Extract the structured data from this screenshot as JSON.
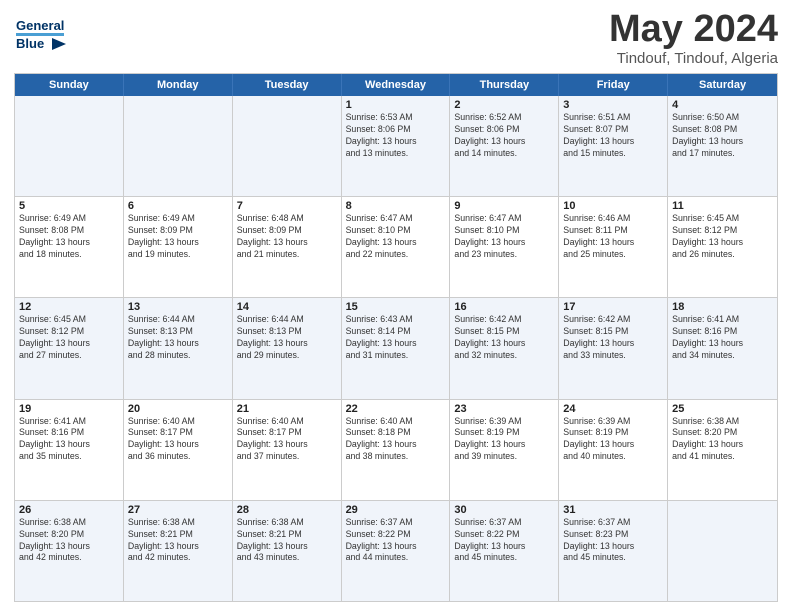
{
  "header": {
    "logo_line1": "General",
    "logo_line2": "Blue",
    "title": "May 2024",
    "location": "Tindouf, Tindouf, Algeria"
  },
  "weekdays": [
    "Sunday",
    "Monday",
    "Tuesday",
    "Wednesday",
    "Thursday",
    "Friday",
    "Saturday"
  ],
  "rows": [
    [
      {
        "day": "",
        "text": ""
      },
      {
        "day": "",
        "text": ""
      },
      {
        "day": "",
        "text": ""
      },
      {
        "day": "1",
        "text": "Sunrise: 6:53 AM\nSunset: 8:06 PM\nDaylight: 13 hours\nand 13 minutes."
      },
      {
        "day": "2",
        "text": "Sunrise: 6:52 AM\nSunset: 8:06 PM\nDaylight: 13 hours\nand 14 minutes."
      },
      {
        "day": "3",
        "text": "Sunrise: 6:51 AM\nSunset: 8:07 PM\nDaylight: 13 hours\nand 15 minutes."
      },
      {
        "day": "4",
        "text": "Sunrise: 6:50 AM\nSunset: 8:08 PM\nDaylight: 13 hours\nand 17 minutes."
      }
    ],
    [
      {
        "day": "5",
        "text": "Sunrise: 6:49 AM\nSunset: 8:08 PM\nDaylight: 13 hours\nand 18 minutes."
      },
      {
        "day": "6",
        "text": "Sunrise: 6:49 AM\nSunset: 8:09 PM\nDaylight: 13 hours\nand 19 minutes."
      },
      {
        "day": "7",
        "text": "Sunrise: 6:48 AM\nSunset: 8:09 PM\nDaylight: 13 hours\nand 21 minutes."
      },
      {
        "day": "8",
        "text": "Sunrise: 6:47 AM\nSunset: 8:10 PM\nDaylight: 13 hours\nand 22 minutes."
      },
      {
        "day": "9",
        "text": "Sunrise: 6:47 AM\nSunset: 8:10 PM\nDaylight: 13 hours\nand 23 minutes."
      },
      {
        "day": "10",
        "text": "Sunrise: 6:46 AM\nSunset: 8:11 PM\nDaylight: 13 hours\nand 25 minutes."
      },
      {
        "day": "11",
        "text": "Sunrise: 6:45 AM\nSunset: 8:12 PM\nDaylight: 13 hours\nand 26 minutes."
      }
    ],
    [
      {
        "day": "12",
        "text": "Sunrise: 6:45 AM\nSunset: 8:12 PM\nDaylight: 13 hours\nand 27 minutes."
      },
      {
        "day": "13",
        "text": "Sunrise: 6:44 AM\nSunset: 8:13 PM\nDaylight: 13 hours\nand 28 minutes."
      },
      {
        "day": "14",
        "text": "Sunrise: 6:44 AM\nSunset: 8:13 PM\nDaylight: 13 hours\nand 29 minutes."
      },
      {
        "day": "15",
        "text": "Sunrise: 6:43 AM\nSunset: 8:14 PM\nDaylight: 13 hours\nand 31 minutes."
      },
      {
        "day": "16",
        "text": "Sunrise: 6:42 AM\nSunset: 8:15 PM\nDaylight: 13 hours\nand 32 minutes."
      },
      {
        "day": "17",
        "text": "Sunrise: 6:42 AM\nSunset: 8:15 PM\nDaylight: 13 hours\nand 33 minutes."
      },
      {
        "day": "18",
        "text": "Sunrise: 6:41 AM\nSunset: 8:16 PM\nDaylight: 13 hours\nand 34 minutes."
      }
    ],
    [
      {
        "day": "19",
        "text": "Sunrise: 6:41 AM\nSunset: 8:16 PM\nDaylight: 13 hours\nand 35 minutes."
      },
      {
        "day": "20",
        "text": "Sunrise: 6:40 AM\nSunset: 8:17 PM\nDaylight: 13 hours\nand 36 minutes."
      },
      {
        "day": "21",
        "text": "Sunrise: 6:40 AM\nSunset: 8:17 PM\nDaylight: 13 hours\nand 37 minutes."
      },
      {
        "day": "22",
        "text": "Sunrise: 6:40 AM\nSunset: 8:18 PM\nDaylight: 13 hours\nand 38 minutes."
      },
      {
        "day": "23",
        "text": "Sunrise: 6:39 AM\nSunset: 8:19 PM\nDaylight: 13 hours\nand 39 minutes."
      },
      {
        "day": "24",
        "text": "Sunrise: 6:39 AM\nSunset: 8:19 PM\nDaylight: 13 hours\nand 40 minutes."
      },
      {
        "day": "25",
        "text": "Sunrise: 6:38 AM\nSunset: 8:20 PM\nDaylight: 13 hours\nand 41 minutes."
      }
    ],
    [
      {
        "day": "26",
        "text": "Sunrise: 6:38 AM\nSunset: 8:20 PM\nDaylight: 13 hours\nand 42 minutes."
      },
      {
        "day": "27",
        "text": "Sunrise: 6:38 AM\nSunset: 8:21 PM\nDaylight: 13 hours\nand 42 minutes."
      },
      {
        "day": "28",
        "text": "Sunrise: 6:38 AM\nSunset: 8:21 PM\nDaylight: 13 hours\nand 43 minutes."
      },
      {
        "day": "29",
        "text": "Sunrise: 6:37 AM\nSunset: 8:22 PM\nDaylight: 13 hours\nand 44 minutes."
      },
      {
        "day": "30",
        "text": "Sunrise: 6:37 AM\nSunset: 8:22 PM\nDaylight: 13 hours\nand 45 minutes."
      },
      {
        "day": "31",
        "text": "Sunrise: 6:37 AM\nSunset: 8:23 PM\nDaylight: 13 hours\nand 45 minutes."
      },
      {
        "day": "",
        "text": ""
      }
    ]
  ],
  "alt_rows": [
    0,
    2,
    4
  ]
}
